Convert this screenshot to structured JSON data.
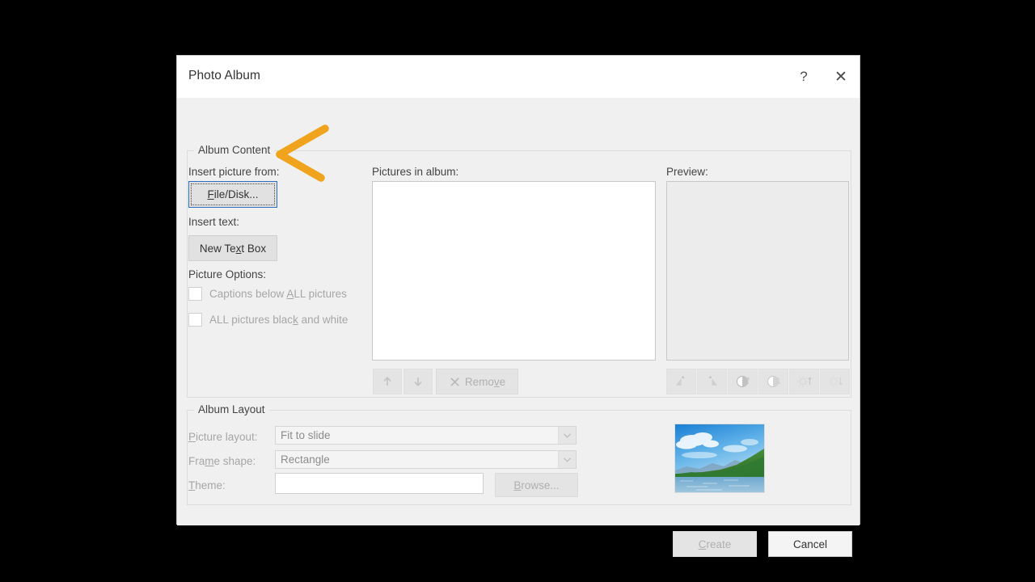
{
  "dialog": {
    "title": "Photo Album",
    "help_icon": "question-mark-icon",
    "close_icon": "close-x-icon"
  },
  "album_content": {
    "legend": "Album Content",
    "insert_picture_label": "Insert picture from:",
    "file_disk_button": "File/Disk...",
    "insert_text_label": "Insert text:",
    "new_text_box_button": "New Text Box",
    "picture_options_label": "Picture Options:",
    "checkboxes": [
      {
        "label": "Captions below ALL pictures",
        "checked": false,
        "enabled": false
      },
      {
        "label": "ALL pictures black and white",
        "checked": false,
        "enabled": false
      }
    ],
    "pictures_in_album_label": "Pictures in album:",
    "pictures_in_album_items": [],
    "preview_label": "Preview:",
    "list_tools": [
      {
        "name": "move-up-button",
        "glyph": "arrow-up-icon",
        "enabled": false
      },
      {
        "name": "move-down-button",
        "glyph": "arrow-down-icon",
        "enabled": false
      }
    ],
    "remove_button": "Remove",
    "remove_enabled": false,
    "picture_tools": [
      {
        "name": "rotate-left-button",
        "icon": "rotate-left-icon",
        "enabled": false
      },
      {
        "name": "rotate-right-button",
        "icon": "rotate-right-icon",
        "enabled": false
      },
      {
        "name": "increase-contrast-button",
        "icon": "contrast-up-icon",
        "enabled": false
      },
      {
        "name": "decrease-contrast-button",
        "icon": "contrast-down-icon",
        "enabled": false
      },
      {
        "name": "increase-brightness-button",
        "icon": "brightness-up-icon",
        "enabled": false
      },
      {
        "name": "decrease-brightness-button",
        "icon": "brightness-down-icon",
        "enabled": false
      }
    ]
  },
  "album_layout": {
    "legend": "Album Layout",
    "picture_layout_label": "Picture layout:",
    "picture_layout_value": "Fit to slide",
    "frame_shape_label": "Frame shape:",
    "frame_shape_value": "Rectangle",
    "theme_label": "Theme:",
    "theme_value": "",
    "browse_button": "Browse...",
    "thumbnail_alt": "landscape-preview-thumbnail"
  },
  "footer": {
    "create_button": "Create",
    "create_enabled": false,
    "cancel_button": "Cancel",
    "cancel_enabled": true
  },
  "annotation": {
    "arrow_icon": "orange-arrow-pointing-left",
    "arrow_color": "#F0A41E",
    "points_to": "File/Disk... button"
  },
  "colors": {
    "dialog_background": "#f0f0f0",
    "titlebar_background": "#ffffff",
    "screen_background": "#000000",
    "focus_border": "#2a6fc0",
    "disabled_text": "#a6a6a6",
    "body_text": "#444444"
  }
}
